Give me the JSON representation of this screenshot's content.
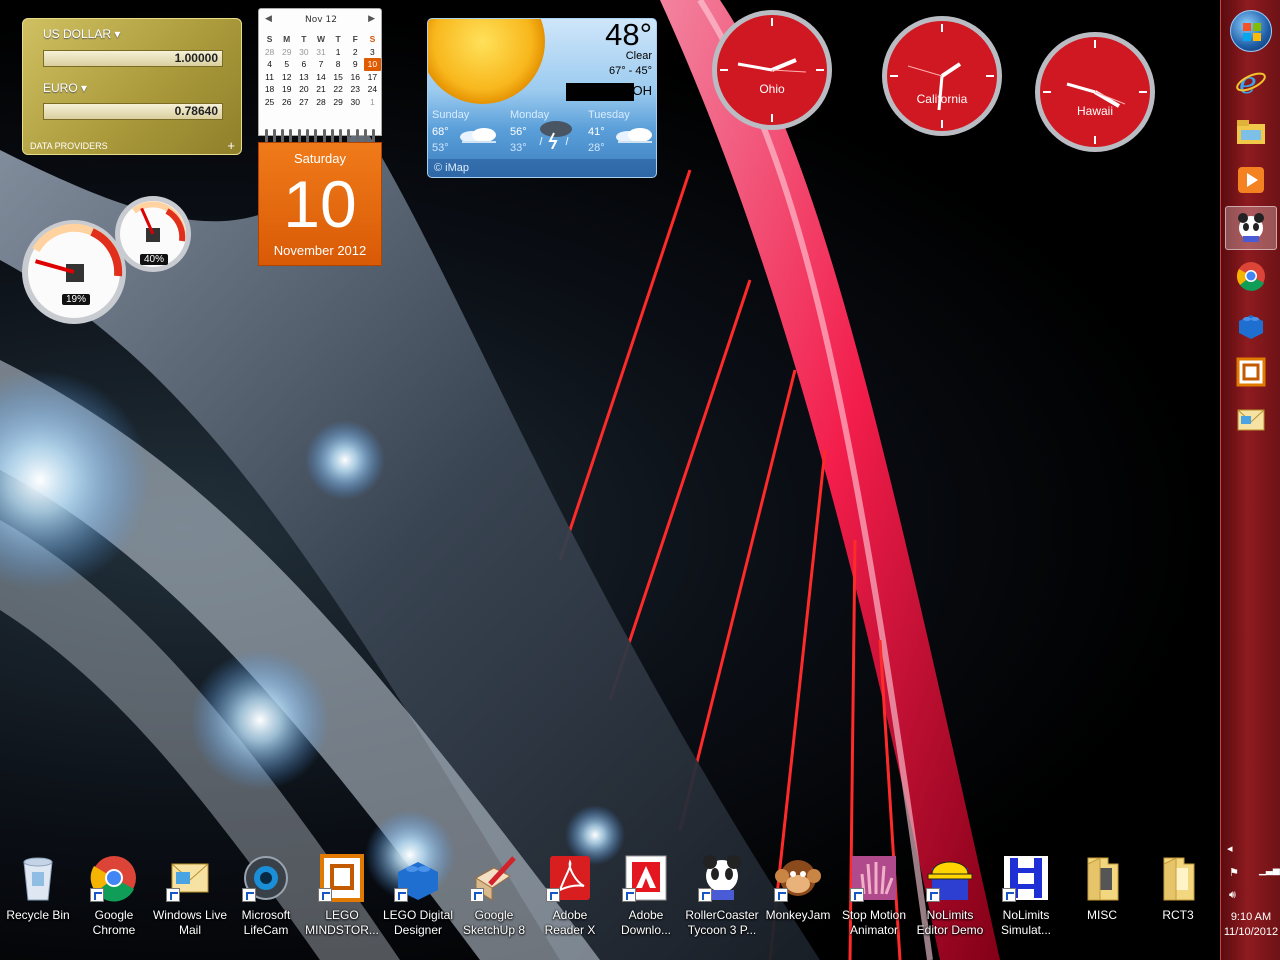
{
  "currency": {
    "from_name": "US DOLLAR",
    "from_value": "1.00000",
    "to_name": "EURO",
    "to_value": "0.78640",
    "providers_label": "DATA PROVIDERS",
    "add_label": "+"
  },
  "calendar": {
    "month_label": "Nov 12",
    "prev_arrow": "◀",
    "next_arrow": "▶",
    "weekday_headers": [
      "S",
      "M",
      "T",
      "W",
      "T",
      "F",
      "S"
    ],
    "weeks": [
      [
        "28",
        "29",
        "30",
        "31",
        "1",
        "2",
        "3"
      ],
      [
        "4",
        "5",
        "6",
        "7",
        "8",
        "9",
        "10"
      ],
      [
        "11",
        "12",
        "13",
        "14",
        "15",
        "16",
        "17"
      ],
      [
        "18",
        "19",
        "20",
        "21",
        "22",
        "23",
        "24"
      ],
      [
        "25",
        "26",
        "27",
        "28",
        "29",
        "30",
        "1"
      ]
    ],
    "selected_day": "10",
    "day_of_week": "Saturday",
    "day_number": "10",
    "month_year": "November 2012"
  },
  "weather": {
    "temperature": "48°",
    "condition": "Clear",
    "range": "67° - 45°",
    "location": "OH",
    "forecast": [
      {
        "day": "Sunday",
        "high": "68°",
        "low": "53°",
        "icon": "cloudy-icon"
      },
      {
        "day": "Monday",
        "high": "56°",
        "low": "33°",
        "icon": "thunderstorm-icon"
      },
      {
        "day": "Tuesday",
        "high": "41°",
        "low": "28°",
        "icon": "cloudy-icon"
      }
    ],
    "footer": "© iMap"
  },
  "clocks": [
    {
      "label": "Ohio"
    },
    {
      "label": "California"
    },
    {
      "label": "Hawaii"
    }
  ],
  "meters": {
    "cpu_value": "19%",
    "cpu_fraction": 0.19,
    "memory_value": "40%",
    "memory_fraction": 0.4
  },
  "taskbar": {
    "pinned": [
      {
        "name": "internet-explorer-icon"
      },
      {
        "name": "windows-explorer-icon"
      },
      {
        "name": "media-player-icon"
      },
      {
        "name": "panda-app-icon",
        "active": true
      },
      {
        "name": "chrome-icon"
      },
      {
        "name": "lego-digital-designer-icon"
      },
      {
        "name": "lego-mindstorms-icon"
      },
      {
        "name": "windows-live-mail-icon"
      }
    ],
    "time": "9:10 AM",
    "date": "11/10/2012"
  },
  "desktop_icons": [
    {
      "label": "Recycle Bin",
      "icon": "recycle-bin-icon"
    },
    {
      "label": "Google Chrome",
      "icon": "chrome-icon"
    },
    {
      "label": "Windows Live Mail",
      "icon": "mail-icon"
    },
    {
      "label": "Microsoft LifeCam",
      "icon": "webcam-icon"
    },
    {
      "label": "LEGO MINDSTOR...",
      "icon": "lego-mindstorms-icon"
    },
    {
      "label": "LEGO Digital Designer",
      "icon": "lego-brick-icon"
    },
    {
      "label": "Google SketchUp 8",
      "icon": "sketchup-icon"
    },
    {
      "label": "Adobe Reader X",
      "icon": "adobe-reader-icon"
    },
    {
      "label": "Adobe Downlo...",
      "icon": "adobe-download-icon"
    },
    {
      "label": "RollerCoaster Tycoon 3 P...",
      "icon": "panda-icon"
    },
    {
      "label": "MonkeyJam",
      "icon": "monkey-icon"
    },
    {
      "label": "Stop Motion Animator",
      "icon": "hand-icon"
    },
    {
      "label": "NoLimits Editor Demo",
      "icon": "hardhat-icon"
    },
    {
      "label": "NoLimits Simulat...",
      "icon": "coaster-track-icon"
    },
    {
      "label": "MISC",
      "icon": "folder-icon"
    },
    {
      "label": "RCT3",
      "icon": "folder-icon"
    }
  ],
  "colors": {
    "taskbar": "#8e1b1f",
    "calendar_orange": "#e8680f",
    "clock_red": "#d01822",
    "weather_blue": "#5a9fd9"
  }
}
